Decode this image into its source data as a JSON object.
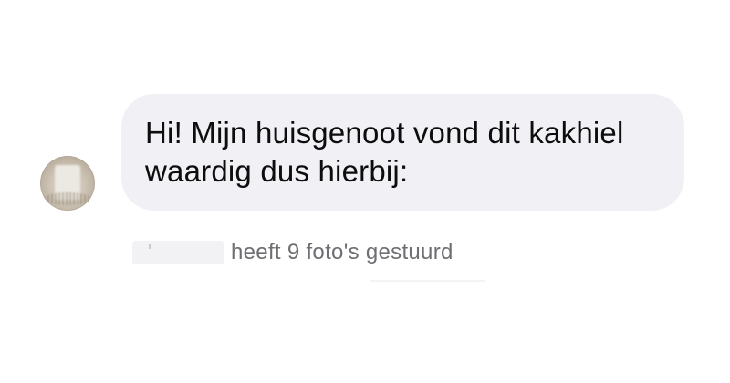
{
  "conversation": {
    "incoming_message": {
      "text": "Hi! Mijn huisgenoot vond dit kakhiel waardig dus hierbij:"
    },
    "photo_notice": {
      "text": "heeft 9 foto's gestuurd"
    }
  },
  "theme": {
    "bubble_color": "#f0f0f5",
    "text_color": "#0d0d0d",
    "meta_text_color": "#6e6e73"
  }
}
